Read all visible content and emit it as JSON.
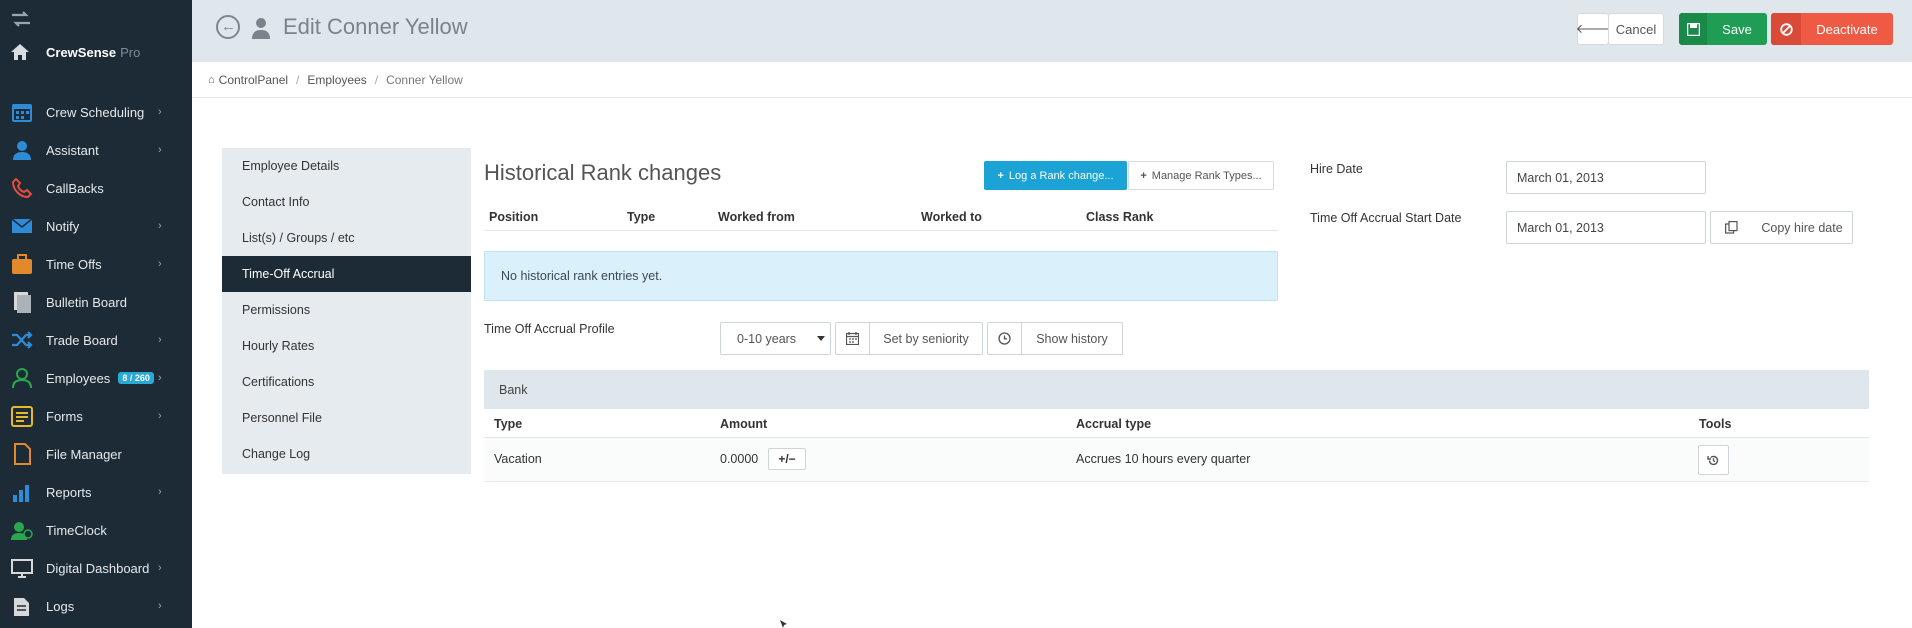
{
  "app": {
    "name": "CrewSense",
    "edition": "Pro"
  },
  "sidebar": {
    "items": [
      {
        "label": "Crew Scheduling",
        "icon": "calendar-icon",
        "color": "#2e8bd8",
        "chevron": true
      },
      {
        "label": "Assistant",
        "icon": "assistant-icon",
        "color": "#2e8bd8",
        "chevron": true
      },
      {
        "label": "CallBacks",
        "icon": "phone-icon",
        "color": "#e84c3d",
        "chevron": false
      },
      {
        "label": "Notify",
        "icon": "envelope-icon",
        "color": "#2e8bd8",
        "chevron": true
      },
      {
        "label": "Time Offs",
        "icon": "briefcase-icon",
        "color": "#e28a2b",
        "chevron": true
      },
      {
        "label": "Bulletin Board",
        "icon": "document-icon",
        "color": "#d8d8d8",
        "chevron": false
      },
      {
        "label": "Trade Board",
        "icon": "shuffle-icon",
        "color": "#2e8bd8",
        "chevron": true
      },
      {
        "label": "Employees",
        "icon": "user-icon",
        "color": "#2aa74e",
        "chevron": true,
        "badge": "8 / 260"
      },
      {
        "label": "Forms",
        "icon": "form-icon",
        "color": "#e8b82b",
        "chevron": true
      },
      {
        "label": "File Manager",
        "icon": "file-icon",
        "color": "#e28a2b",
        "chevron": false
      },
      {
        "label": "Reports",
        "icon": "bar-chart-icon",
        "color": "#2e8bd8",
        "chevron": true
      },
      {
        "label": "TimeClock",
        "icon": "timeclock-icon",
        "color": "#2aa74e",
        "chevron": false
      },
      {
        "label": "Digital Dashboard",
        "icon": "monitor-icon",
        "color": "#d8d8d8",
        "chevron": true
      },
      {
        "label": "Logs",
        "icon": "logs-icon",
        "color": "#d8d8d8",
        "chevron": true
      }
    ]
  },
  "header": {
    "title": "Edit Conner Yellow",
    "cancel_label": "Cancel",
    "save_label": "Save",
    "deactivate_label": "Deactivate"
  },
  "breadcrumb": {
    "items": [
      "ControlPanel",
      "Employees",
      "Conner Yellow"
    ]
  },
  "left_menu": {
    "items": [
      "Employee Details",
      "Contact Info",
      "List(s) / Groups / etc",
      "Time-Off Accrual",
      "Permissions",
      "Hourly Rates",
      "Certifications",
      "Personnel File",
      "Change Log"
    ],
    "active": "Time-Off Accrual"
  },
  "rank_history": {
    "title": "Historical Rank changes",
    "log_button": "Log a Rank change...",
    "manage_button": "Manage Rank Types...",
    "columns": [
      "Position",
      "Type",
      "Worked from",
      "Worked to",
      "Class Rank"
    ],
    "empty_message": "No historical rank entries yet."
  },
  "accrual": {
    "profile_label": "Time Off Accrual Profile",
    "profile_value": "0-10 years",
    "seniority_button": "Set by seniority",
    "history_button": "Show history"
  },
  "bank": {
    "title": "Bank",
    "columns": [
      "Type",
      "Amount",
      "Accrual type",
      "Tools"
    ],
    "rows": [
      {
        "type": "Vacation",
        "amount": "0.0000",
        "accrual_type": "Accrues 10 hours every quarter"
      }
    ],
    "pm_label": "+/−"
  },
  "dates": {
    "hire_label": "Hire Date",
    "hire_value": "March 01, 2013",
    "accrual_start_label": "Time Off Accrual Start Date",
    "accrual_start_value": "March 01, 2013",
    "copy_button": "Copy hire date"
  },
  "colors": {
    "sidebar": "#1c2b36",
    "header": "#dfe7ec",
    "save": "#1f9d55",
    "deactivate": "#ef5a45",
    "primary": "#1aa3d4"
  }
}
